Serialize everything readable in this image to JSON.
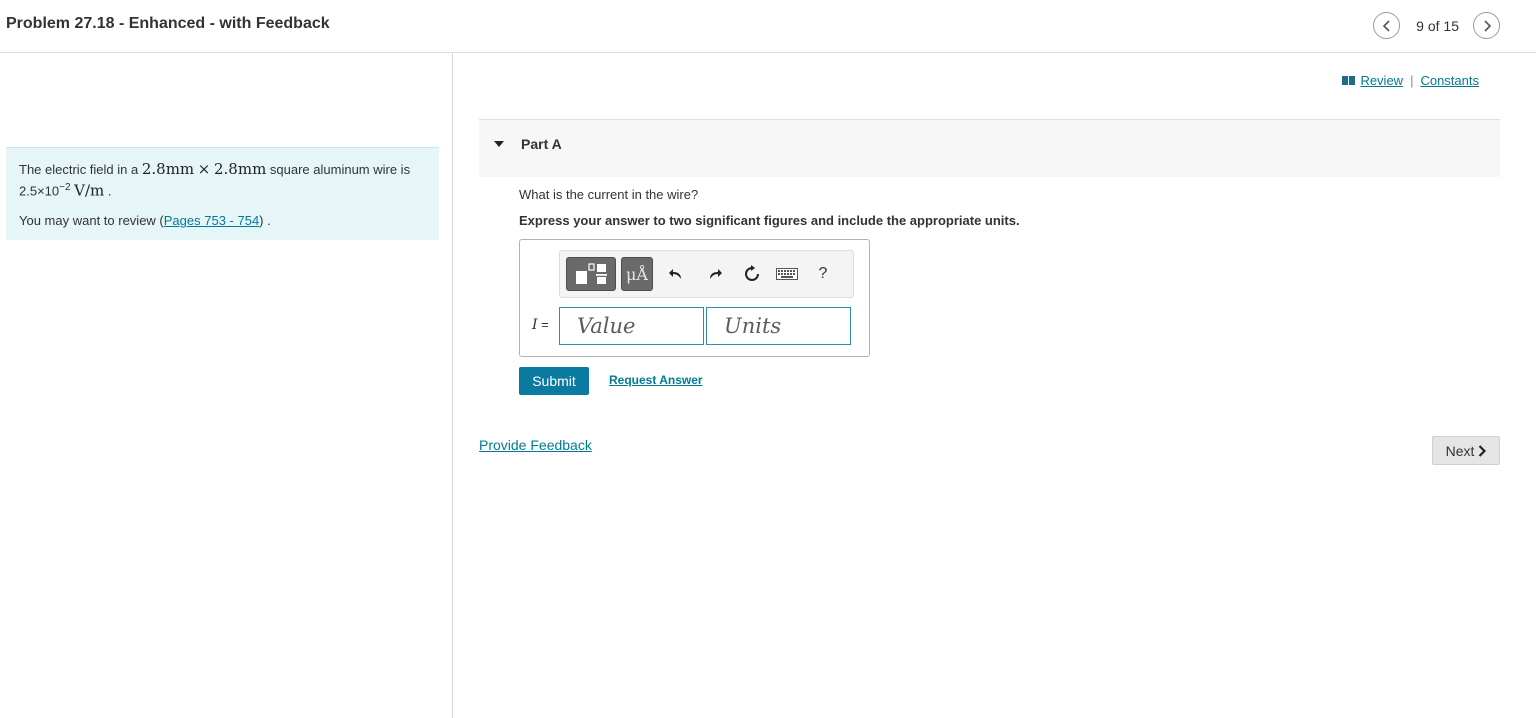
{
  "header": {
    "title": "Problem 27.18 - Enhanced - with Feedback",
    "pager_text": "9 of 15",
    "icons": {
      "prev": "chevron-left-icon",
      "next": "chevron-right-icon"
    }
  },
  "problem": {
    "text_before": "The electric field in a ",
    "dim_a": "2.8mm",
    "times": "×",
    "dim_b": "2.8mm",
    "text_after": " square aluminum wire is",
    "field_mantissa": "2.5×10",
    "field_exponent": "−2",
    "field_units": "V/m",
    "field_end": ".",
    "review_prefix": "You may want to review (",
    "review_link": "Pages 753 - 754",
    "review_suffix": ") ."
  },
  "top_links": {
    "review": "Review",
    "separator": "|",
    "constants": "Constants",
    "icon": "book-icon"
  },
  "part": {
    "title": "Part A",
    "question": "What is the current in the wire?",
    "instruction": "Express your answer to two significant figures and include the appropriate units."
  },
  "toolbar": {
    "units_label": "μÅ",
    "help_label": "?",
    "icons": [
      "templates-icon",
      "units-icon",
      "undo-icon",
      "redo-icon",
      "reset-icon",
      "keyboard-icon",
      "help-icon"
    ]
  },
  "answer": {
    "variable": "I",
    "equals": " =",
    "value_placeholder": "Value",
    "units_placeholder": "Units"
  },
  "actions": {
    "submit": "Submit",
    "request_answer": "Request Answer",
    "provide_feedback": "Provide Feedback",
    "next": "Next"
  },
  "colors": {
    "accent": "#0a7aa0",
    "link": "#007a96",
    "problem_bg": "#e6f5f7",
    "input_border": "#2e8ea5"
  }
}
